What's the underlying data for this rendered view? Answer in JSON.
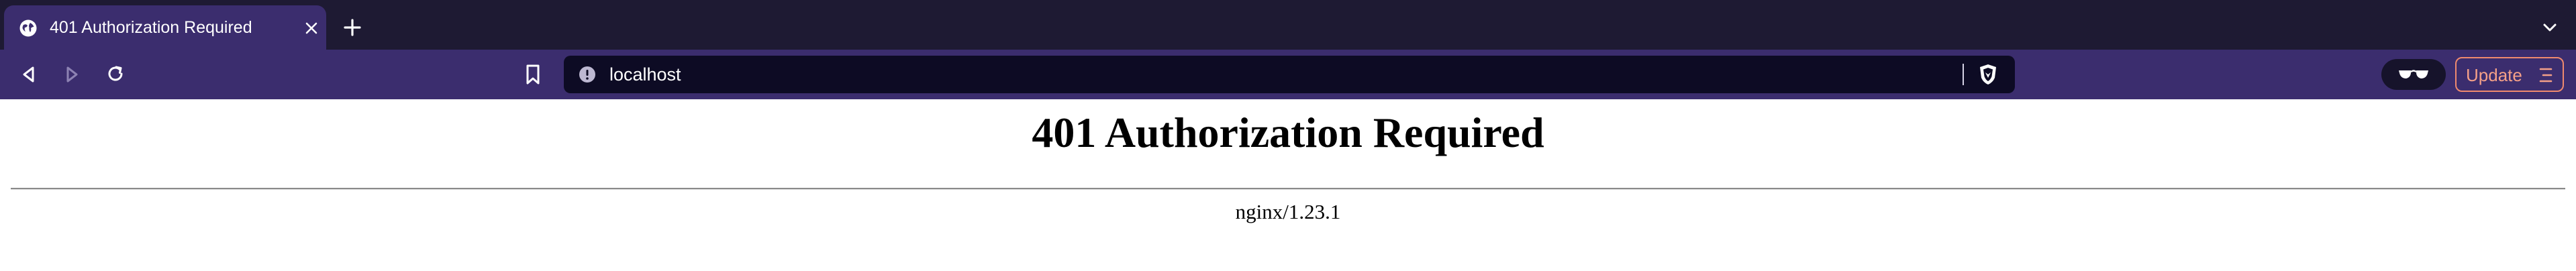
{
  "browser": {
    "tab": {
      "title": "401 Authorization Required",
      "favicon": "globe-icon",
      "close_icon": "close-icon"
    },
    "new_tab_icon": "plus-icon",
    "tab_list_icon": "chevron-down-icon",
    "toolbar": {
      "back_icon": "back-icon",
      "forward_icon": "forward-icon",
      "reload_icon": "reload-icon",
      "bookmark_icon": "bookmark-icon",
      "url": "localhost",
      "site_info_icon": "info-icon",
      "shields_icon": "brave-shields-icon",
      "vpn_icon": "glasses-icon",
      "update_label": "Update",
      "update_menu_icon": "menu-icon"
    },
    "colors": {
      "tabstrip_bg": "#1e1a33",
      "toolbar_bg": "#3b2d6e",
      "urlbar_bg": "#0d0b24",
      "update_accent": "#f08a6e"
    }
  },
  "page": {
    "heading": "401 Authorization Required",
    "server": "nginx/1.23.1"
  }
}
